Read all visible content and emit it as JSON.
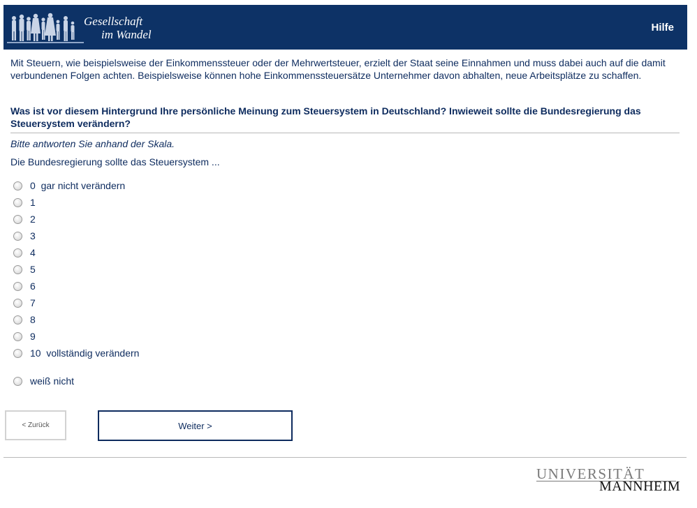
{
  "header": {
    "logo_line1": "Gesellschaft",
    "logo_line2": "im Wandel",
    "help_label": "Hilfe",
    "bg_color": "#0d3266"
  },
  "intro": "Mit Steuern, wie beispielsweise der Einkommenssteuer oder der Mehrwertsteuer, erzielt der Staat seine Einnahmen und muss dabei auch auf die damit verbundenen Folgen achten. Beispielsweise können hohe Einkommenssteuersätze Unternehmer davon abhalten, neue Arbeitsplätze zu schaffen.",
  "question": "Was ist vor diesem Hintergrund Ihre persönliche Meinung zum Steuersystem in Deutschland? Inwieweit sollte die Bundesregierung das Steuersystem verändern?",
  "instruction": "Bitte antworten Sie anhand der Skala.",
  "stem": "Die Bundesregierung sollte das Steuersystem ...",
  "options": [
    {
      "label": "0  gar nicht verändern"
    },
    {
      "label": "1"
    },
    {
      "label": "2"
    },
    {
      "label": "3"
    },
    {
      "label": "4"
    },
    {
      "label": "5"
    },
    {
      "label": "6"
    },
    {
      "label": "7"
    },
    {
      "label": "8"
    },
    {
      "label": "9"
    },
    {
      "label": "10  vollständig verändern"
    },
    {
      "label": "weiß nicht"
    }
  ],
  "nav": {
    "back_label": "< Zurück",
    "next_label": "Weiter >"
  },
  "footer": {
    "uni_line1": "UNIVERSITÄT",
    "uni_line2": "MANNHEIM"
  }
}
